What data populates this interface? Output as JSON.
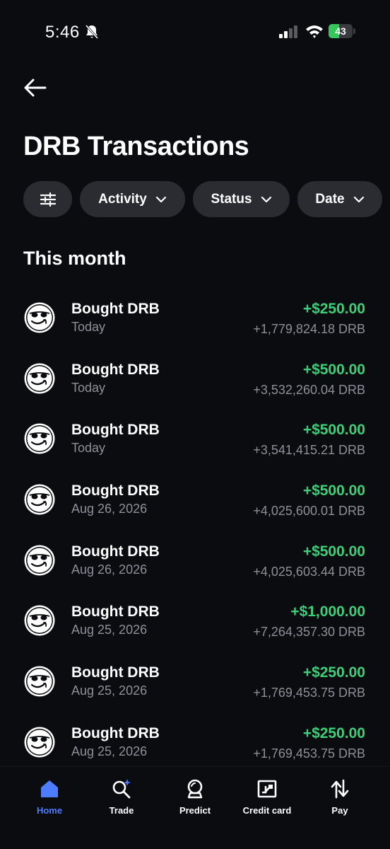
{
  "status_bar": {
    "time": "5:46",
    "battery_text": "43",
    "battery_level": 0.43
  },
  "header": {
    "title": "DRB Transactions"
  },
  "filters": {
    "activity": "Activity",
    "status": "Status",
    "date": "Date"
  },
  "section": {
    "title": "This month"
  },
  "transactions": [
    {
      "title": "Bought DRB",
      "date": "Today",
      "amount": "+$250.00",
      "crypto": "+1,779,824.18 DRB"
    },
    {
      "title": "Bought DRB",
      "date": "Today",
      "amount": "+$500.00",
      "crypto": "+3,532,260.04 DRB"
    },
    {
      "title": "Bought DRB",
      "date": "Today",
      "amount": "+$500.00",
      "crypto": "+3,541,415.21 DRB"
    },
    {
      "title": "Bought DRB",
      "date": "Aug 26, 2026",
      "amount": "+$500.00",
      "crypto": "+4,025,600.01 DRB"
    },
    {
      "title": "Bought DRB",
      "date": "Aug 26, 2026",
      "amount": "+$500.00",
      "crypto": "+4,025,603.44 DRB"
    },
    {
      "title": "Bought DRB",
      "date": "Aug 25, 2026",
      "amount": "+$1,000.00",
      "crypto": "+7,264,357.30 DRB"
    },
    {
      "title": "Bought DRB",
      "date": "Aug 25, 2026",
      "amount": "+$250.00",
      "crypto": "+1,769,453.75 DRB"
    },
    {
      "title": "Bought DRB",
      "date": "Aug 25, 2026",
      "amount": "+$250.00",
      "crypto": "+1,769,453.75 DRB"
    }
  ],
  "nav": {
    "home": "Home",
    "trade": "Trade",
    "predict": "Predict",
    "credit_card": "Credit card",
    "pay": "Pay"
  },
  "colors": {
    "background": "#0b0c0f",
    "chip": "#2a2c31",
    "positive": "#3ecf7a",
    "secondary_text": "#8d9099",
    "active_nav": "#4d7cff",
    "battery": "#34c759"
  },
  "icons": {
    "status": [
      "bell-slash-icon",
      "signal-icon",
      "wifi-icon",
      "battery-icon"
    ],
    "header": "arrow-left-icon",
    "filter": "sliders-icon",
    "avatar": "drb-face-icon",
    "nav": [
      "home-icon",
      "search-sparkle-icon",
      "crystal-ball-icon",
      "card-icon",
      "transfer-arrows-icon"
    ]
  }
}
